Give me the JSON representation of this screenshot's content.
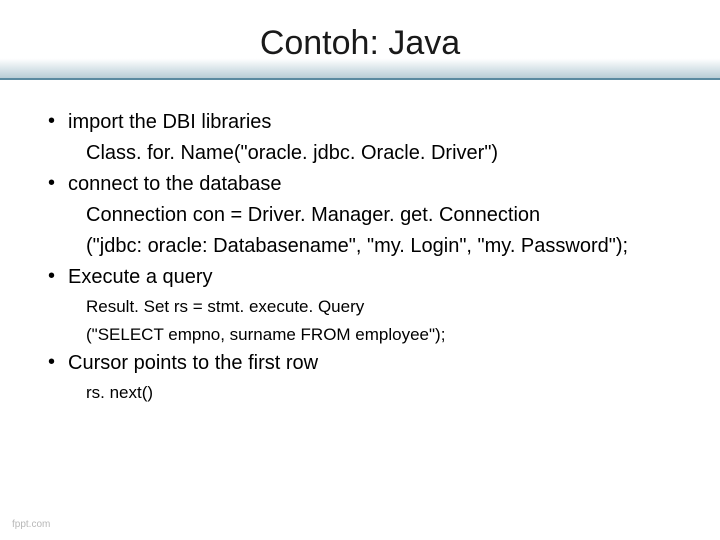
{
  "title": "Contoh: Java",
  "items": [
    {
      "type": "bullet",
      "text": "import the DBI libraries"
    },
    {
      "type": "indent",
      "text": "Class. for. Name(\"oracle. jdbc. Oracle. Driver\")"
    },
    {
      "type": "bullet",
      "text": "connect to the database"
    },
    {
      "type": "indent",
      "text": "Connection con = Driver. Manager. get. Connection"
    },
    {
      "type": "indent",
      "text": "(\"jdbc: oracle: Databasename\", \"my. Login\", \"my. Password\");"
    },
    {
      "type": "bullet",
      "text": "Execute a query"
    },
    {
      "type": "sub",
      "text": "Result. Set rs = stmt. execute. Query"
    },
    {
      "type": "sub",
      "text": "(\"SELECT empno, surname FROM employee\");"
    },
    {
      "type": "bullet",
      "text": "Cursor points to the first row"
    },
    {
      "type": "sub",
      "text": "rs. next()"
    }
  ],
  "footer": "fppt.com"
}
